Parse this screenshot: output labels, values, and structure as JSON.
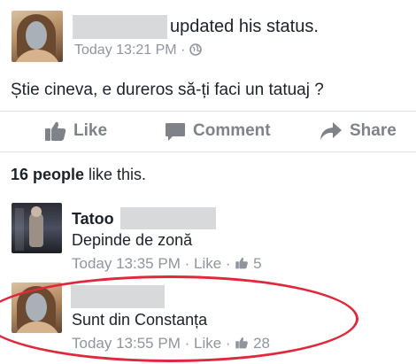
{
  "post": {
    "author_suffix": "updated his status.",
    "time": "Today 13:21 PM",
    "separator": "·",
    "text": "Știe cineva, e dureros să-ți faci un tatuaj ?"
  },
  "actions": {
    "like": "Like",
    "comment": "Comment",
    "share": "Share"
  },
  "likes_summary": {
    "count_text": "16 people",
    "rest": " like this."
  },
  "comments": [
    {
      "author": "Tatoo",
      "text": "Depinde de zonă",
      "time": "Today 13:35 PM",
      "like_label": "Like",
      "like_count": "5"
    },
    {
      "author": "",
      "text": "Sunt din Constanța",
      "time": "Today 13:55 PM",
      "like_label": "Like",
      "like_count": "28"
    }
  ],
  "colors": {
    "highlight": "#e0283c",
    "meta_gray": "#90949c",
    "action_gray": "#7f8389"
  }
}
